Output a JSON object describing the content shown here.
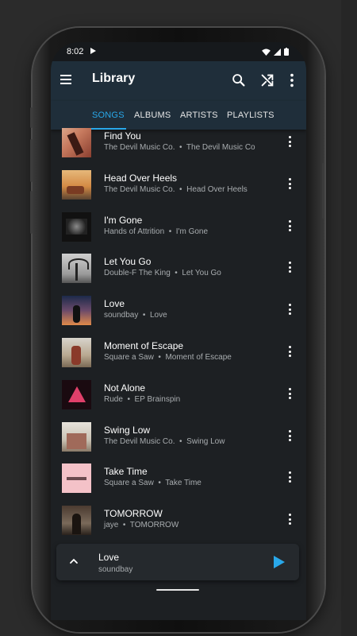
{
  "status": {
    "time": "8:02"
  },
  "appbar": {
    "title": "Library"
  },
  "tabs": [
    "SONGS",
    "ALBUMS",
    "ARTISTS",
    "PLAYLISTS"
  ],
  "songs": [
    {
      "title": "Find You",
      "artist": "The Devil Music Co.",
      "album": "The Devil Music Co"
    },
    {
      "title": "Head Over Heels",
      "artist": "The Devil Music Co.",
      "album": "Head Over Heels"
    },
    {
      "title": "I'm Gone",
      "artist": "Hands of Attrition",
      "album": "I'm Gone"
    },
    {
      "title": "Let You Go",
      "artist": "Double-F The King",
      "album": "Let You Go"
    },
    {
      "title": "Love",
      "artist": "soundbay",
      "album": "Love"
    },
    {
      "title": "Moment of Escape",
      "artist": "Square a Saw",
      "album": "Moment of Escape"
    },
    {
      "title": "Not Alone",
      "artist": "Rude",
      "album": "EP Brainspin"
    },
    {
      "title": "Swing Low",
      "artist": "The Devil Music Co.",
      "album": "Swing Low"
    },
    {
      "title": "Take Time",
      "artist": "Square a Saw",
      "album": "Take Time"
    },
    {
      "title": "TOMORROW",
      "artist": "jaye",
      "album": "TOMORROW"
    }
  ],
  "now_playing": {
    "title": "Love",
    "artist": "soundbay"
  },
  "colors": {
    "accent": "#29a8ea",
    "appbar": "#1f2e3a",
    "background": "#1d2023"
  }
}
